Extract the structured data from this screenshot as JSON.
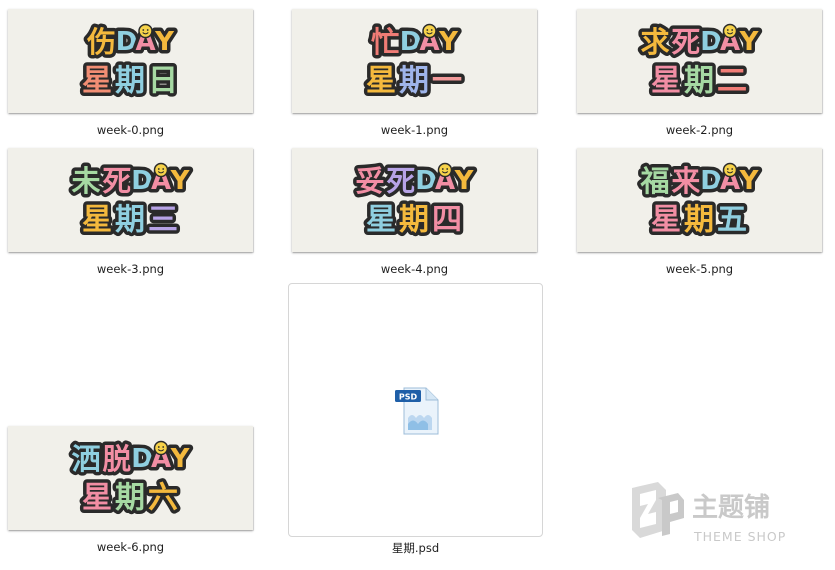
{
  "files": [
    {
      "name": "week-0.png",
      "line1": "伤",
      "line2": "星期日",
      "line1_colors": [
        "#f4b93d"
      ],
      "line2_colors": [
        "#f28e74",
        "#8fcfe0",
        "#a6d9a3"
      ]
    },
    {
      "name": "week-1.png",
      "line1": "忙",
      "line2": "星期一",
      "line1_colors": [
        "#f07c76"
      ],
      "line2_colors": [
        "#f4b93d",
        "#9fb5ea",
        "#f39a9a"
      ]
    },
    {
      "name": "week-2.png",
      "line1": "求死",
      "line2": "星期二",
      "line1_colors": [
        "#f4b93d",
        "#f28ea4"
      ],
      "line2_colors": [
        "#f28ea4",
        "#a6d9a3",
        "#f07c76"
      ]
    },
    {
      "name": "week-3.png",
      "line1": "未死",
      "line2": "星期三",
      "line1_colors": [
        "#a6d9a3",
        "#f28ea4"
      ],
      "line2_colors": [
        "#f4b93d",
        "#8fcfe0",
        "#b7a3e6"
      ]
    },
    {
      "name": "week-4.png",
      "line1": "妥死",
      "line2": "星期四",
      "line1_colors": [
        "#f28ea4",
        "#b7a3e6"
      ],
      "line2_colors": [
        "#8fcfe0",
        "#f4b93d",
        "#f28ea4"
      ]
    },
    {
      "name": "week-5.png",
      "line1": "福来",
      "line2": "星期五",
      "line1_colors": [
        "#a6d9a3",
        "#f28ea4"
      ],
      "line2_colors": [
        "#f28ea4",
        "#f4b93d",
        "#8fcfe0"
      ]
    },
    {
      "name": "week-6.png",
      "line1": "洒脱",
      "line2": "星期六",
      "line1_colors": [
        "#8fcfe0",
        "#f28ea4"
      ],
      "line2_colors": [
        "#f28ea4",
        "#a6d9a3",
        "#f4b93d"
      ]
    },
    {
      "name": "星期.psd",
      "icon": "psd-file-icon",
      "badge": "PSD"
    }
  ],
  "day_word": "DAY",
  "day_colors": [
    "#8fcfe0",
    "#f28ea4",
    "#f4b93d"
  ],
  "watermark": {
    "cn": "主题铺",
    "en": "THEME SHOP"
  }
}
